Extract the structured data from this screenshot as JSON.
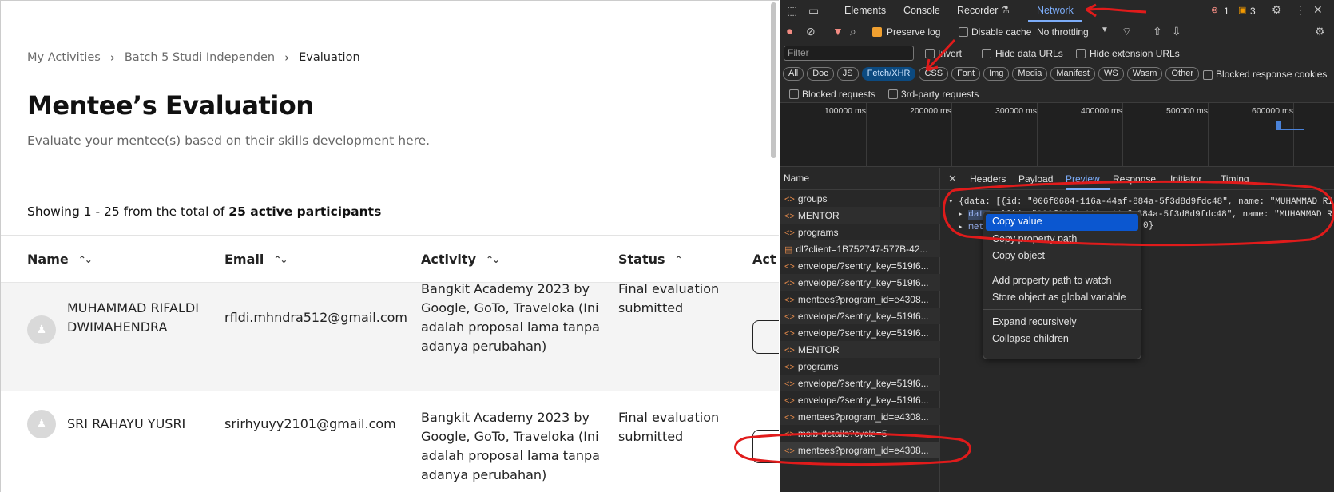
{
  "page": {
    "breadcrumb": [
      "My Activities",
      "Batch 5 Studi Independen",
      "Evaluation"
    ],
    "title": "Mentee’s Evaluation",
    "subtitle": "Evaluate your mentee(s) based on their skills development here.",
    "showing_prefix": "Showing 1 - 25 from the total of",
    "showing_bold": "25 active participants",
    "columns": [
      "Name",
      "Email",
      "Activity",
      "Status",
      "Act"
    ],
    "rows": [
      {
        "name": [
          "MUHAMMAD RIFALDI",
          "DWIMAHENDRA"
        ],
        "email": "rfldi.mhndra512@gmail.com",
        "activity": [
          "Bangkit Academy 2023 by",
          "Google, GoTo, Traveloka (Ini",
          "adalah proposal lama tanpa",
          "adanya perubahan)"
        ],
        "status": [
          "Final evaluation",
          "submitted"
        ]
      },
      {
        "name": [
          "SRI RAHAYU YUSRI"
        ],
        "email": "srirhyuyy2101@gmail.com",
        "activity": [
          "Bangkit Academy 2023 by",
          "Google, GoTo, Traveloka (Ini",
          "adalah proposal lama tanpa",
          "adanya perubahan)"
        ],
        "status": [
          "Final evaluation",
          "submitted"
        ]
      }
    ]
  },
  "devtools": {
    "tabs": [
      "Elements",
      "Console",
      "Recorder",
      "Network"
    ],
    "active_tab": "Network",
    "errors": "1",
    "warnings": "3",
    "preserve_log": "Preserve log",
    "disable_cache": "Disable cache",
    "throttling": "No throttling",
    "filter_placeholder": "Filter",
    "invert": "Invert",
    "hide_data_urls": "Hide data URLs",
    "hide_extension_urls": "Hide extension URLs",
    "types": [
      "All",
      "Doc",
      "JS",
      "Fetch/XHR",
      "CSS",
      "Font",
      "Img",
      "Media",
      "Manifest",
      "WS",
      "Wasm",
      "Other"
    ],
    "active_type": "Fetch/XHR",
    "blocked_response_cookies": "Blocked response cookies",
    "blocked_requests": "Blocked requests",
    "third_party": "3rd-party requests",
    "timeline_labels": [
      "100000 ms",
      "200000 ms",
      "300000 ms",
      "400000 ms",
      "500000 ms",
      "600000 ms"
    ],
    "name_header": "Name",
    "requests": [
      "groups",
      "MENTOR",
      "programs",
      "dl?client=1B752747-577B-42...",
      "envelope/?sentry_key=519f6...",
      "envelope/?sentry_key=519f6...",
      "mentees?program_id=e4308...",
      "envelope/?sentry_key=519f6...",
      "envelope/?sentry_key=519f6...",
      "MENTOR",
      "programs",
      "envelope/?sentry_key=519f6...",
      "envelope/?sentry_key=519f6...",
      "mentees?program_id=e4308...",
      "msib-details?cycle=5",
      "mentees?program_id=e4308..."
    ],
    "detail_tabs": [
      "Headers",
      "Payload",
      "Preview",
      "Response",
      "Initiator",
      "Timing"
    ],
    "active_detail_tab": "Preview",
    "preview_line1": "{data: [{id: \"006f0684-116a-44af-884a-5f3d8d9fdc48\", name: \"MUHAMMAD RI",
    "preview_line2_key": "data",
    "preview_line2": ": [{id: \"006f0684-116a-44af-884a-5f3d8d9fdc48\", name: \"MUHAMMAD R",
    "preview_line3_key": "met",
    "preview_line3": "0}",
    "context_menu": [
      "Copy value",
      "Copy property path",
      "Copy object",
      "Add property path to watch",
      "Store object as global variable",
      "Expand recursively",
      "Collapse children"
    ]
  }
}
